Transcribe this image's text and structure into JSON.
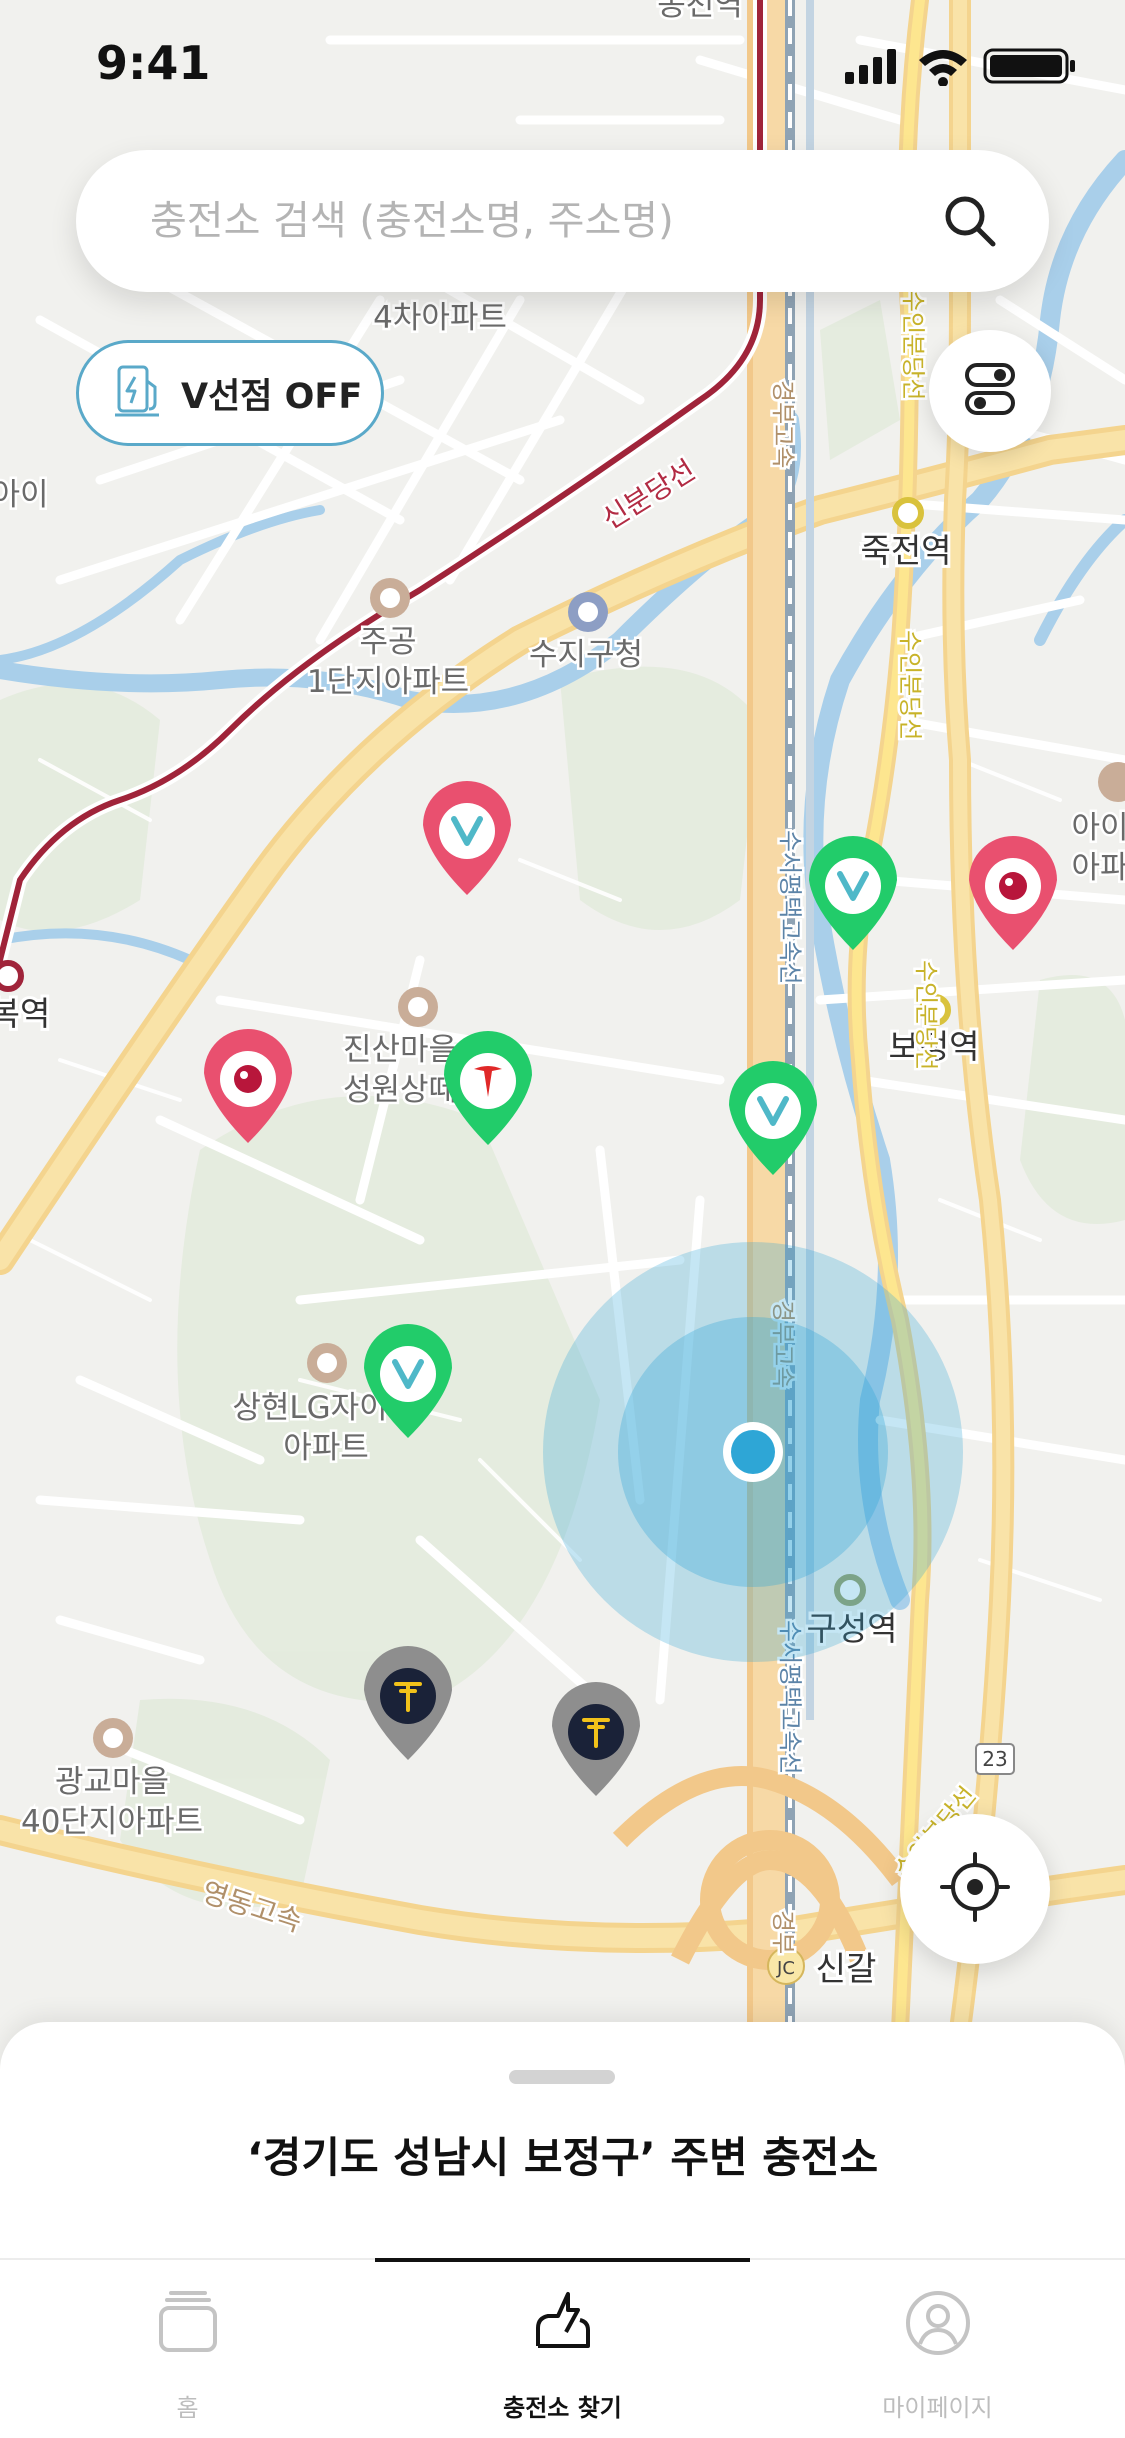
{
  "status_bar": {
    "time": "9:41"
  },
  "search": {
    "placeholder": "충전소 검색 (충전소명, 주소명)",
    "value": ""
  },
  "v_toggle": {
    "label": "V선점 OFF"
  },
  "map": {
    "labels": {
      "apt4": "4차아파트",
      "shinbundang": "신분당선",
      "jukjeon": "죽전역",
      "jugong1": "주공",
      "jugong2": "1단지아파트",
      "suji": "수지구청",
      "bojeong": "보정역",
      "jinsan1": "진산마을",
      "jinsan2": "성원상떼",
      "sanghyeon1": "상현LG자이",
      "sanghyeon2": "아파트",
      "guseong": "구성역",
      "gwanggyo1": "광교마을",
      "gwanggyo2": "40단지아파트",
      "yeongdong": "영동고속",
      "singal": "신갈",
      "jc": "JC",
      "route23": "23",
      "bokjeong": "복역",
      "ai": "아이",
      "ai2": "아이",
      "ai3": "아파",
      "gyeongbu1": "경부고속",
      "gyeongbu2": "경부고속",
      "gyeongbu3": "경부",
      "suseo1": "수서평택고속선",
      "suseo2": "수서평택고속선",
      "suin1": "수인분당선",
      "suin2": "수인분당선",
      "suin3": "수인분당선",
      "suin4": "수인분당선",
      "top": "동천역"
    },
    "markers": [
      {
        "brand": "V",
        "color": "#e9506f"
      },
      {
        "brand": "V",
        "color": "#22cc6a"
      },
      {
        "brand": "LG",
        "color": "#e9506f"
      },
      {
        "brand": "LG",
        "color": "#e9506f"
      },
      {
        "brand": "Tesla",
        "color": "#22cc6a"
      },
      {
        "brand": "V",
        "color": "#22cc6a"
      },
      {
        "brand": "V",
        "color": "#22cc6a"
      },
      {
        "brand": "T",
        "color": "#8e8e8e"
      },
      {
        "brand": "T",
        "color": "#8e8e8e"
      }
    ],
    "accent_user_location": "#2ea6d6"
  },
  "bottom_sheet": {
    "title": "‘경기도 성남시 보정구’ 주변 충전소"
  },
  "tabs": [
    {
      "label": "홈",
      "icon": "wallet-icon"
    },
    {
      "label": "충전소 찾기",
      "icon": "charging-bolt-icon"
    },
    {
      "label": "마이페이지",
      "icon": "profile-icon"
    }
  ]
}
